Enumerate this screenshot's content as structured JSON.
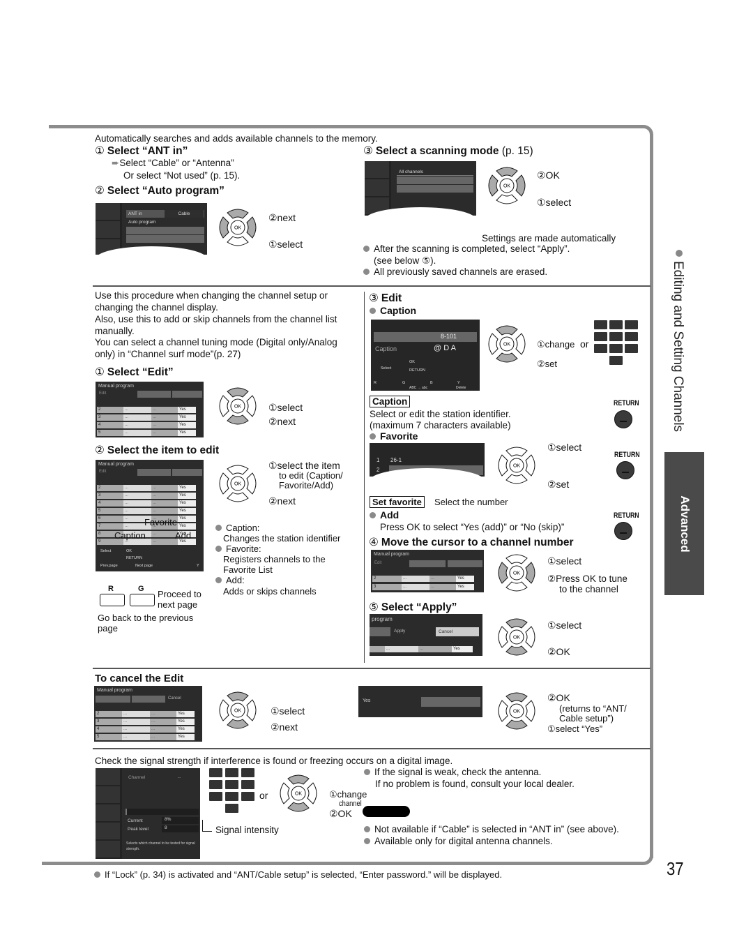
{
  "page": {
    "number": "37",
    "side_title": "Editing and Setting Channels",
    "side_tab": "Advanced",
    "footer_note": "If “Lock” (p. 34) is activated and “ANT/Cable setup” is selected, “Enter password.” will be displayed."
  },
  "auto_program": {
    "intro": "Automatically searches and adds available channels to the memory.",
    "step1": {
      "num": "①",
      "title": "Select “ANT in”",
      "arrow_note": "Select “Cable” or “Antenna”",
      "note2": "Or select “Not used” (p. 15)."
    },
    "step2": {
      "num": "②",
      "title": "Select “Auto program”",
      "screen": {
        "row1_label": "ANT in",
        "row1_value": "Cable",
        "row2_label": "Auto program"
      },
      "callouts": [
        "②next",
        "①select"
      ]
    },
    "step3": {
      "num": "③",
      "title": "Select a scanning mode",
      "page_ref": "(p. 15)",
      "screen": {
        "row1_label": "All channels"
      },
      "callouts": [
        "②OK",
        "①select"
      ]
    },
    "auto_note": "Settings are made automatically",
    "bullets": [
      "After the scanning is completed, select “Apply”.",
      "(see below ⑤).",
      "All previously saved channels are erased."
    ]
  },
  "manual_edit": {
    "intro_lines": [
      "Use this procedure when changing the channel setup or",
      "changing the channel display.",
      "Also, use this to add or skip channels from the channel list",
      "manually.",
      "You can select a channel tuning mode (Digital only/Analog",
      "only) in “Channel surf mode”(p. 27)"
    ],
    "step1": {
      "num": "①",
      "title": "Select “Edit”",
      "screen": {
        "title": "Manual program",
        "edit_label": "Edit",
        "rows": [
          [
            "2",
            "...",
            "...",
            "Yes"
          ],
          [
            "3",
            "...",
            "...",
            "Yes"
          ],
          [
            "4",
            "...",
            "...",
            "Yes"
          ],
          [
            "5",
            "...",
            "...",
            "Yes"
          ]
        ]
      },
      "callouts": [
        "①select",
        "②next"
      ]
    },
    "step2": {
      "num": "②",
      "title": "Select the item to edit",
      "screen": {
        "title": "Manual program",
        "edit_label": "Edit",
        "rows": [
          [
            "2",
            "...",
            "...",
            "Yes"
          ],
          [
            "3",
            "...",
            "...",
            "Yes"
          ],
          [
            "4",
            "...",
            "...",
            "Yes"
          ],
          [
            "5",
            "...",
            "...",
            "Yes"
          ],
          [
            "6",
            "...",
            "...",
            "Yes"
          ],
          [
            "7",
            "...",
            "...",
            "Yes"
          ],
          [
            "8",
            "...",
            "...",
            "Yes"
          ],
          [
            "9",
            "...",
            "...",
            "Yes"
          ]
        ],
        "overlay_labels": {
          "favorite": "Favorite",
          "caption": "Caption",
          "add": "Add"
        },
        "footer": {
          "select": "Select",
          "ok": "OK",
          "return": "RETURN",
          "prev": "Prev.page",
          "next": "Next page",
          "y": "Y"
        }
      },
      "callouts": [
        "①select the item",
        "to edit (Caption/",
        "Favorite/Add)",
        "②next"
      ],
      "buttons": {
        "r": "R",
        "g": "G"
      },
      "proceed": [
        "Proceed to",
        "next page"
      ],
      "go_back": [
        "Go back to the previous",
        "page"
      ],
      "bullets": [
        {
          "term": "Caption:",
          "desc": "Changes the station identifier"
        },
        {
          "term": "Favorite:",
          "desc": "Registers channels to the",
          "desc2": "Favorite List"
        },
        {
          "term": "Add:",
          "desc": "Adds or skips channels"
        }
      ]
    },
    "step3": {
      "num": "③",
      "title": "Edit",
      "caption": {
        "heading": "Caption",
        "screen": {
          "channel": "8-101",
          "label": "Caption",
          "value": "@ D A",
          "select": "Select",
          "ok": "OK",
          "return": "RETURN",
          "r": "R",
          "g": "G",
          "b": "B",
          "y": "Y",
          "abc": "ABC → abc",
          "delete": "Delete"
        },
        "callouts": [
          "①change",
          "②set"
        ],
        "or": "or",
        "box_label": "Caption",
        "desc": [
          "Select or edit the station identifier.",
          "(maximum 7 characters available)"
        ],
        "return_label": "RETURN"
      },
      "favorite": {
        "heading": "Favorite",
        "screen": {
          "row1_num": "1",
          "row1_value": "26-1",
          "row2_num": "2"
        },
        "callouts": [
          "①select",
          "②set"
        ],
        "box_label": "Set favorite",
        "desc": "Select the number",
        "return_label": "RETURN"
      },
      "add": {
        "heading": "Add",
        "desc": "Press OK to select “Yes (add)” or “No (skip)”",
        "return_label": "RETURN"
      }
    },
    "step4": {
      "num": "④",
      "title": "Move the cursor to a channel number",
      "screen": {
        "title": "Manual program",
        "edit_label": "Edit",
        "rows": [
          [
            "2",
            "...",
            "...",
            "Yes"
          ],
          [
            "3",
            "...",
            "...",
            "Yes"
          ]
        ]
      },
      "callouts": [
        "①select",
        "②Press OK to tune",
        "to the channel"
      ]
    },
    "step5": {
      "num": "⑤",
      "title": "Select “Apply”",
      "screen": {
        "title": "program",
        "apply": "Apply",
        "cancel": "Cancel",
        "row": [
          "...",
          "...",
          "Yes"
        ]
      },
      "callouts": [
        "①select",
        "②OK"
      ]
    }
  },
  "cancel_edit": {
    "title": "To cancel the Edit",
    "screen": {
      "title": "Manual program",
      "cancel": "Cancel",
      "rows": [
        [
          "2",
          "...",
          "...",
          "Yes"
        ],
        [
          "3",
          "...",
          "...",
          "Yes"
        ],
        [
          "4",
          "...",
          "...",
          "Yes"
        ],
        [
          "5",
          "...",
          "...",
          "Yes"
        ]
      ]
    },
    "callouts": [
      "①select",
      "②next"
    ],
    "confirm_screen": {
      "yes": "Yes"
    },
    "confirm_callouts": [
      "②OK",
      "(returns to “ANT/",
      "Cable setup”)",
      "①select “Yes”"
    ]
  },
  "signal": {
    "intro": "Check the signal strength if interference is found or freezing occurs on a digital image.",
    "screen": {
      "channel_label": "Channel",
      "channel_value": "--",
      "current_label": "Current",
      "current_value": "8%",
      "peak_label": "Peak level",
      "peak_value": "8",
      "help": "Selects which channel to be tested for signal strength."
    },
    "or": "or",
    "callouts": [
      "①change",
      "channel",
      "②OK"
    ],
    "signal_label": "Signal intensity",
    "bullets": [
      "If the signal is weak, check the antenna.",
      "If no problem is found, consult your local dealer.",
      "Not available if “Cable” is selected in “ANT in” (see above).",
      "Available only for digital antenna channels."
    ]
  },
  "dpad": {
    "ok": "OK"
  }
}
